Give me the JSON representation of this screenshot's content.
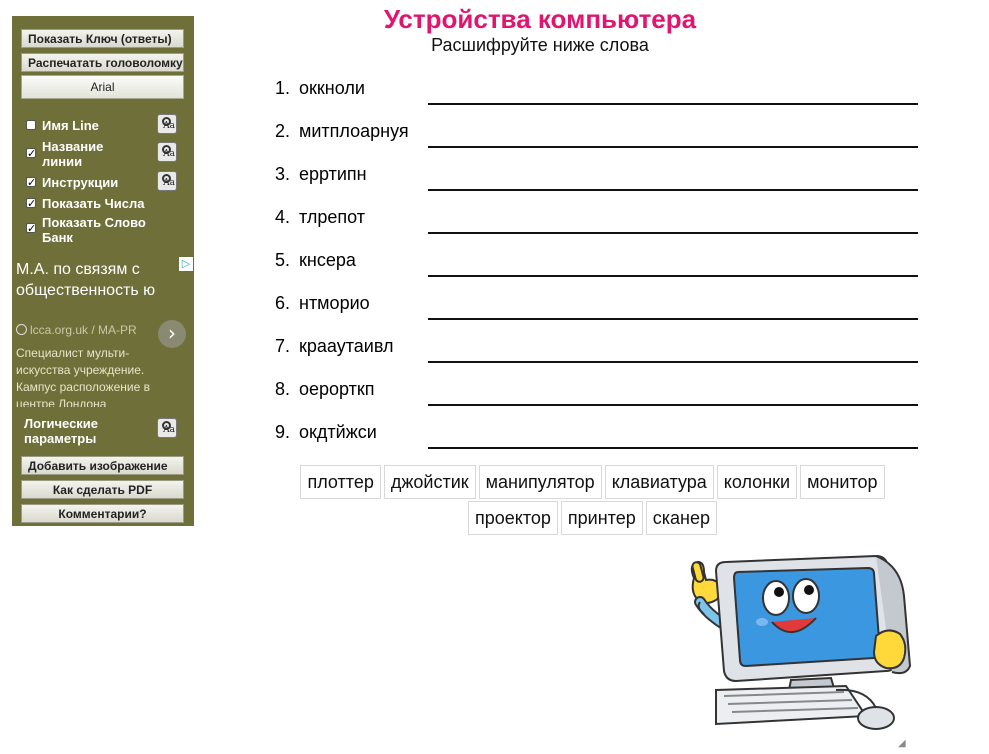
{
  "sidebar": {
    "buttons": {
      "show_key": "Показать Ключ (ответы)",
      "print": "Распечатать головоломку",
      "add_image": "Добавить изображение",
      "make_pdf": "Как сделать PDF",
      "comments": "Комментарии?"
    },
    "font_select": {
      "value": "Arial"
    },
    "options": [
      {
        "label": "Имя Line",
        "checked": false
      },
      {
        "label": "Название линии",
        "checked": true
      },
      {
        "label": "Инструкции",
        "checked": true
      },
      {
        "label": "Показать Числа",
        "checked": true
      },
      {
        "label": "Показать Слово Банк",
        "checked": true
      }
    ],
    "logic_label": "Логические параметры",
    "font_icon_text": "Aa"
  },
  "ad": {
    "title": "М.А. по связям с общественность ю",
    "url": "lcca.org.uk / MA-PR",
    "description": "Специалист мульти-искусства учреждение. Кампус расположение в центре Лондона",
    "arrow": "›",
    "badge": "▷"
  },
  "puzzle": {
    "title": "Устройства компьютера",
    "subtitle": "Расшифруйте ниже слова",
    "items": [
      {
        "num": "1.",
        "word": "оккноли"
      },
      {
        "num": "2.",
        "word": "митплоарнуя"
      },
      {
        "num": "3.",
        "word": "ерртипн"
      },
      {
        "num": "4.",
        "word": "тлрепот"
      },
      {
        "num": "5.",
        "word": "кнсера"
      },
      {
        "num": "6.",
        "word": "нтморио"
      },
      {
        "num": "7.",
        "word": "крааутаивл"
      },
      {
        "num": "8.",
        "word": "оерорткп"
      },
      {
        "num": "9.",
        "word": "окдтйжси"
      }
    ],
    "word_bank": [
      "плоттер",
      "джойстик",
      "манипулятор",
      "клавиатура",
      "колонки",
      "монитор",
      "проектор",
      "принтер",
      "сканер"
    ]
  },
  "colors": {
    "sidebar_bg": "#6f6f3a",
    "title": "#e0156f"
  },
  "icons": {
    "resize": "resize-grip-icon"
  }
}
